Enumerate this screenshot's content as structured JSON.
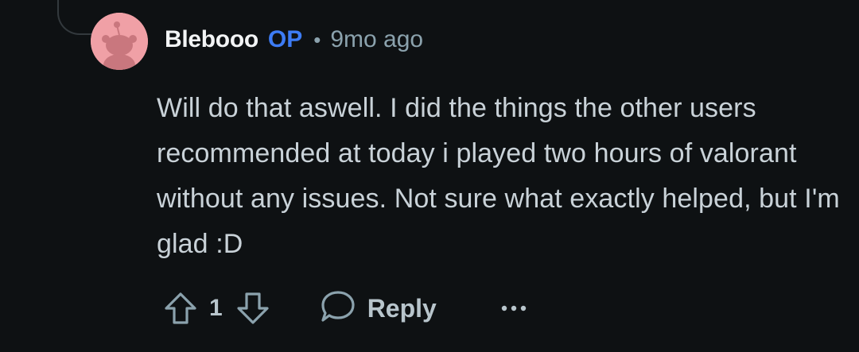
{
  "comment": {
    "author": "Blebooo",
    "op_badge": "OP",
    "separator": "•",
    "timestamp": "9mo ago",
    "body": "Will do that aswell. I did the things the other users recommended at today i played two hours of valorant without any issues. Not sure what exactly helped, but I'm glad :D",
    "avatar_icon": "snoo-avatar-icon",
    "avatar_color": "#f0a0a6"
  },
  "actions": {
    "upvote_icon": "arrow-up-icon",
    "vote_count": "1",
    "downvote_icon": "arrow-down-icon",
    "reply_icon": "speech-bubble-icon",
    "reply_label": "Reply",
    "more_icon": "ellipsis-icon"
  },
  "colors": {
    "background": "#0e1113",
    "username": "#f2f4f5",
    "op_badge": "#3d7cf5",
    "meta": "#8ba2ad",
    "body_text": "#c9d2d8"
  }
}
